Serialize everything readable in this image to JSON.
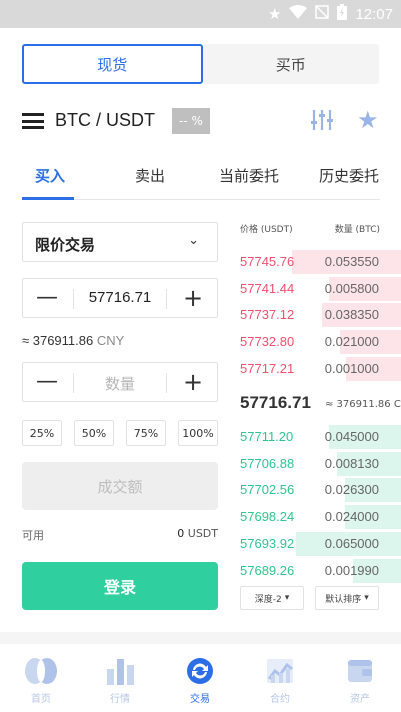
{
  "status_bar": {
    "time": "12:07"
  },
  "segment": {
    "spot": "现货",
    "buy_coin": "买币"
  },
  "pair": {
    "name": "BTC / USDT",
    "change": "-- %"
  },
  "tabs": [
    "买入",
    "卖出",
    "当前委托",
    "历史委托"
  ],
  "order_form": {
    "order_type": "限价交易",
    "price_value": "57716.71",
    "approx_value": "≈ 376911.86",
    "approx_unit": "CNY",
    "amount_placeholder": "数量",
    "percent_buttons": [
      "25%",
      "50%",
      "75%",
      "100%"
    ],
    "turnover_label": "成交额",
    "available_label": "可用",
    "available_value": "0",
    "available_unit": "USDT",
    "login_button": "登录"
  },
  "orderbook": {
    "header_price": "价格 (USDT)",
    "header_amount": "数量 (BTC)",
    "asks": [
      {
        "price": "57745.76",
        "amount": "0.053550",
        "depth": 0.68
      },
      {
        "price": "57741.44",
        "amount": "0.005800",
        "depth": 0.45
      },
      {
        "price": "57737.12",
        "amount": "0.038350",
        "depth": 0.49
      },
      {
        "price": "57732.80",
        "amount": "0.021000",
        "depth": 0.38
      },
      {
        "price": "57717.21",
        "amount": "0.001000",
        "depth": 0.34
      }
    ],
    "last_price": "57716.71",
    "last_price_cny": "≈ 376911.86 CNY",
    "bids": [
      {
        "price": "57711.20",
        "amount": "0.045000",
        "depth": 0.45
      },
      {
        "price": "57706.88",
        "amount": "0.008130",
        "depth": 0.4
      },
      {
        "price": "57702.56",
        "amount": "0.026300",
        "depth": 0.35
      },
      {
        "price": "57698.24",
        "amount": "0.024000",
        "depth": 0.35
      },
      {
        "price": "57693.92",
        "amount": "0.065000",
        "depth": 0.65
      },
      {
        "price": "57689.26",
        "amount": "0.001990",
        "depth": 0.3
      }
    ],
    "depth_select": "深度-2",
    "sort_select": "默认排序"
  },
  "bottom_nav": [
    {
      "label": "首页",
      "icon": "home-icon"
    },
    {
      "label": "行情",
      "icon": "market-icon"
    },
    {
      "label": "交易",
      "icon": "trade-icon",
      "active": true
    },
    {
      "label": "合约",
      "icon": "contract-icon"
    },
    {
      "label": "资产",
      "icon": "wallet-icon"
    }
  ],
  "colors": {
    "accent": "#2b6ee6",
    "buy": "#2fcf9f",
    "sell": "#f0506e"
  }
}
